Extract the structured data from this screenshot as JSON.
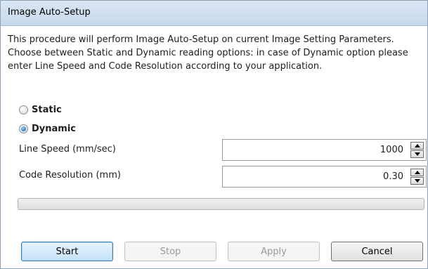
{
  "window": {
    "title": "Image Auto-Setup"
  },
  "description": "This procedure will perform Image Auto-Setup on current Image Setting Parameters.\nChoose between Static and Dynamic reading options: in case of Dynamic option please enter Line Speed and Code Resolution according to your application.",
  "options": {
    "static_label": "Static",
    "dynamic_label": "Dynamic",
    "selected": "Dynamic"
  },
  "fields": {
    "line_speed": {
      "label": "Line Speed (mm/sec)",
      "value": "1000"
    },
    "code_resolution": {
      "label": "Code Resolution (mm)",
      "value": "0.30"
    }
  },
  "progress": {
    "percent": 0
  },
  "buttons": {
    "start": "Start",
    "stop": "Stop",
    "apply": "Apply",
    "cancel": "Cancel"
  }
}
